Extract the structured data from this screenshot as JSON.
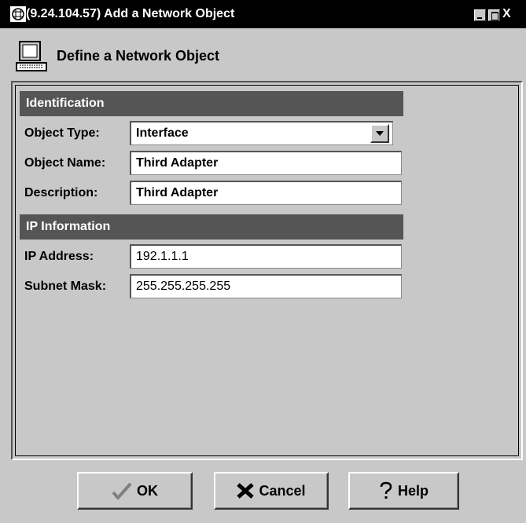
{
  "window": {
    "title": "(9.24.104.57) Add a Network Object",
    "controls": {
      "minimize": "_",
      "maximize": "□",
      "close": "X"
    }
  },
  "header": {
    "title": "Define a Network Object",
    "icon": "computer-monitor-icon"
  },
  "sections": {
    "identification": "Identification",
    "ip_information": "IP Information"
  },
  "fields": {
    "object_type": {
      "label": "Object Type:",
      "value": "Interface"
    },
    "object_name": {
      "label": "Object Name:",
      "value": "Third Adapter"
    },
    "description": {
      "label": "Description:",
      "value": "Third Adapter"
    },
    "ip_address": {
      "label": "IP Address:",
      "value": "192.1.1.1"
    },
    "subnet_mask": {
      "label": "Subnet Mask:",
      "value": "255.255.255.255"
    }
  },
  "buttons": {
    "ok": {
      "label": "OK",
      "icon": "checkmark-icon"
    },
    "cancel": {
      "label": "Cancel",
      "icon": "x-icon"
    },
    "help": {
      "label": "Help",
      "icon": "question-mark-icon"
    }
  },
  "colors": {
    "titlebar": "#000000",
    "background": "#c8c8c8",
    "section_header": "#555555"
  }
}
